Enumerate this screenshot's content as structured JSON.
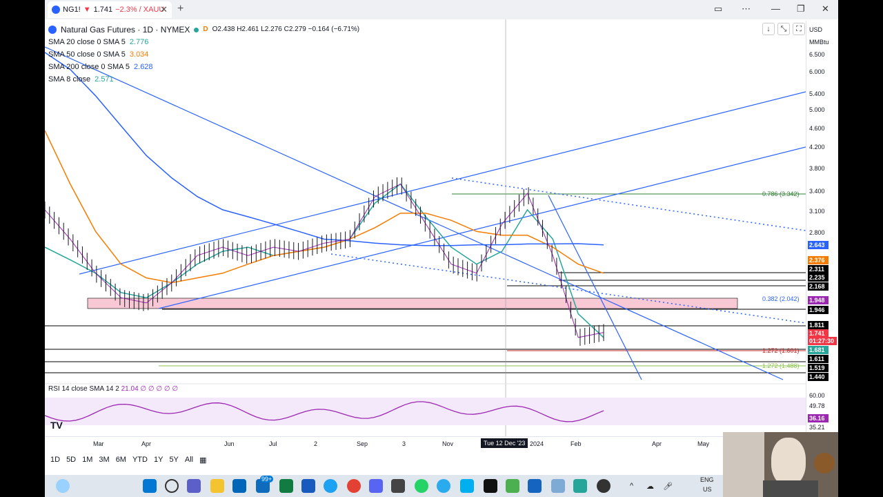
{
  "tab": {
    "title": "NG1! ",
    "price": "1.741",
    "change": "−2.3% / XAUU",
    "close": "✕",
    "new_tab": "+"
  },
  "header": {
    "symbol": "Natural Gas Futures · 1D · NYMEX",
    "interval_badge": "D",
    "ohlc": "O2.438  H2.461  L2.276  C2.279  −0.164 (−6.71%)",
    "indicators": [
      {
        "name": "SMA 20 close 0 SMA 5",
        "value": "2.776",
        "color": "#26a69a"
      },
      {
        "name": "SMA 50 close 0 SMA 5",
        "value": "3.034",
        "color": "#f57c00"
      },
      {
        "name": "SMA 200 close 0 SMA 5",
        "value": "2.628",
        "color": "#2962ff"
      },
      {
        "name": "SMA 8 close",
        "value": "2.571",
        "color": "#26a69a"
      }
    ]
  },
  "scale": {
    "currency": "USD",
    "unit": "MMBtu",
    "ticks": [
      "6.500",
      "6.000",
      "5.400",
      "5.000",
      "4.600",
      "4.200",
      "3.800",
      "3.400",
      "3.100",
      "2.800"
    ],
    "labels": [
      {
        "text": "2.643",
        "color": "#2962ff"
      },
      {
        "text": "2.376",
        "color": "#f57c00"
      },
      {
        "text": "2.311",
        "color": "#000000"
      },
      {
        "text": "2.235",
        "color": "#000000"
      },
      {
        "text": "2.168",
        "color": "#000000"
      },
      {
        "text": "1.948",
        "color": "#9c27b0"
      },
      {
        "text": "1.946",
        "color": "#000000"
      },
      {
        "text": "1.811",
        "color": "#000000"
      },
      {
        "text": "1.741",
        "color": "#f23645"
      },
      {
        "text": "01:27:30",
        "color": "#f23645"
      },
      {
        "text": "1.681",
        "color": "#26a69a"
      },
      {
        "text": "1.611",
        "color": "#000000"
      },
      {
        "text": "1.519",
        "color": "#000000"
      },
      {
        "text": "1.440",
        "color": "#000000"
      }
    ],
    "rsi_ticks": [
      "60.00",
      "49.78",
      "35.21"
    ],
    "rsi_label": "36.16"
  },
  "fib": {
    "f786": "0.786 (3.342)",
    "f382": "0.382 (2.042)",
    "f1272a": "1.272 (1.601)",
    "f1272b": "1.272 (1.488)"
  },
  "rsi": {
    "label": "RSI 14 close SMA 14 2",
    "value": "21.04  ∅  ∅     ∅  ∅  ∅"
  },
  "time_axis": {
    "labels": [
      "Mar",
      "Apr",
      "Jun",
      "Jul",
      "2",
      "Sep",
      "3",
      "Nov",
      "2024",
      "Feb",
      "Apr",
      "May"
    ],
    "crosshair": "Tue 12 Dec '23"
  },
  "periods": [
    "1D",
    "5D",
    "1M",
    "3M",
    "6M",
    "YTD",
    "1Y",
    "5Y",
    "All"
  ],
  "taskbar": {
    "lang": "ENG",
    "region": "US",
    "badge_mail": "99+"
  },
  "chart_data": {
    "type": "line",
    "title": "Natural Gas Futures · 1D · NYMEX",
    "ylim": [
      1.44,
      6.5
    ],
    "series": [
      {
        "name": "SMA 20 close 0 SMA 5",
        "values": [
          2.6,
          2.45,
          2.3,
          2.1,
          2.05,
          2.2,
          2.4,
          2.55,
          2.6,
          2.5,
          2.55,
          2.6,
          2.7,
          3.2,
          3.5,
          3.0,
          2.6,
          2.4,
          2.55,
          3.1,
          2.7,
          1.9,
          1.7
        ]
      },
      {
        "name": "SMA 50 close 0 SMA 5",
        "values": [
          4.5,
          3.5,
          2.8,
          2.4,
          2.25,
          2.2,
          2.25,
          2.3,
          2.4,
          2.5,
          2.55,
          2.6,
          2.7,
          2.85,
          3.05,
          3.05,
          2.95,
          2.8,
          2.75,
          2.75,
          2.6,
          2.4,
          2.3
        ]
      },
      {
        "name": "SMA 200 close 0 SMA 5",
        "values": [
          6.5,
          6.0,
          5.3,
          4.6,
          4.0,
          3.6,
          3.3,
          3.1,
          3.0,
          2.9,
          2.8,
          2.7,
          2.68,
          2.65,
          2.63,
          2.62,
          2.62,
          2.63,
          2.63,
          2.64,
          2.64,
          2.643,
          2.628
        ]
      },
      {
        "name": "Price",
        "values": [
          3.1,
          2.7,
          2.3,
          2.05,
          2.0,
          2.2,
          2.5,
          2.6,
          2.5,
          2.6,
          2.55,
          2.65,
          2.7,
          3.3,
          3.5,
          2.9,
          2.4,
          2.3,
          2.9,
          3.35,
          2.5,
          1.7,
          1.741
        ]
      }
    ]
  }
}
